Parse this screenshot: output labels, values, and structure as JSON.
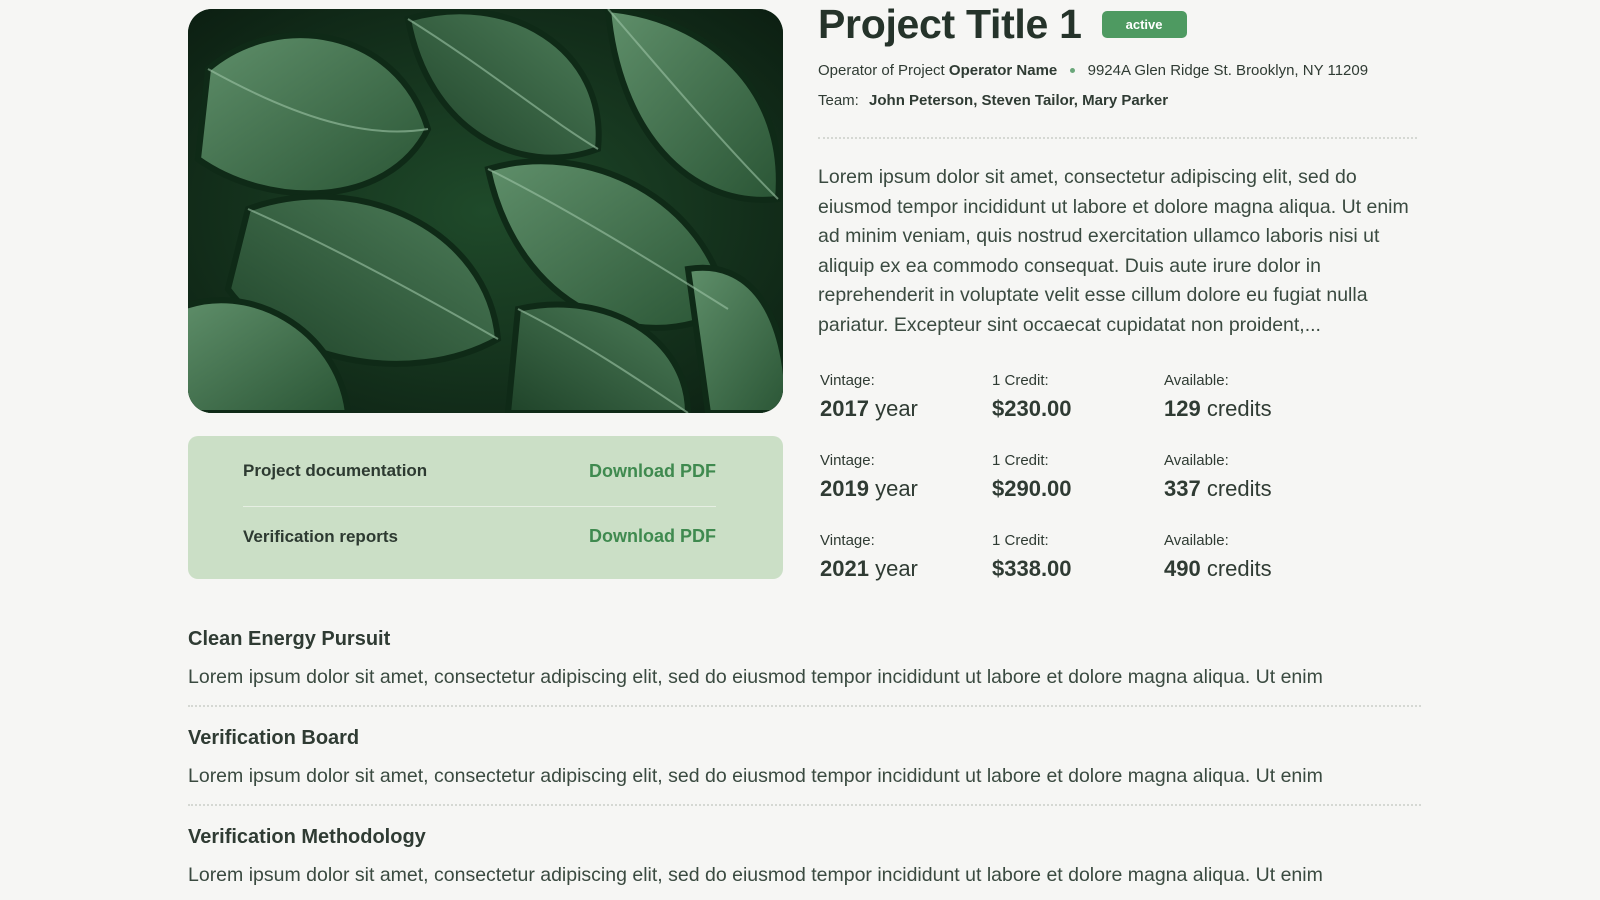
{
  "project": {
    "title": "Project Title 1",
    "status": "active",
    "operator_prefix": "Operator of Project",
    "operator_name": "Operator Name",
    "address": "9924A Glen Ridge St. Brooklyn, NY 11209",
    "team_label": "Team:",
    "team_members": "John Peterson, Steven Tailor, Mary Parker",
    "description": "Lorem ipsum dolor sit amet, consectetur adipiscing elit, sed do eiusmod tempor incididunt ut labore et dolore magna aliqua. Ut enim ad minim veniam, quis nostrud exercitation ullamco laboris nisi ut aliquip ex ea commodo consequat. Duis aute irure dolor in reprehenderit in voluptate velit esse cillum dolore eu fugiat nulla pariatur. Excepteur sint occaecat cupidatat non proident,..."
  },
  "hero_image": {
    "icon": "monstera-leaves-image"
  },
  "documents": [
    {
      "label": "Project documentation",
      "link": "Download PDF"
    },
    {
      "label": "Verification reports",
      "link": "Download PDF"
    }
  ],
  "credits": {
    "vintage_label": "Vintage:",
    "credit_label": "1 Credit:",
    "available_label": "Available:",
    "year_unit": "year",
    "credits_unit": "credits",
    "rows": [
      {
        "vintage": "2017",
        "price": "$230.00",
        "available": "129"
      },
      {
        "vintage": "2019",
        "price": "$290.00",
        "available": "337"
      },
      {
        "vintage": "2021",
        "price": "$338.00",
        "available": "490"
      }
    ]
  },
  "sections": [
    {
      "title": "Clean Energy Pursuit",
      "text": "Lorem ipsum dolor sit amet, consectetur adipiscing elit, sed do eiusmod tempor incididunt ut labore et dolore magna aliqua. Ut enim"
    },
    {
      "title": "Verification Board",
      "text": "Lorem ipsum dolor sit amet, consectetur adipiscing elit, sed do eiusmod tempor incididunt ut labore et dolore magna aliqua. Ut enim"
    },
    {
      "title": "Verification Methodology",
      "text": "Lorem ipsum dolor sit amet, consectetur adipiscing elit, sed do eiusmod tempor incididunt ut labore et dolore magna aliqua. Ut enim"
    }
  ],
  "colors": {
    "background": "#f6f6f4",
    "accent": "#4e9a61",
    "panel": "#cbdfc6",
    "link": "#3f8a4f"
  }
}
